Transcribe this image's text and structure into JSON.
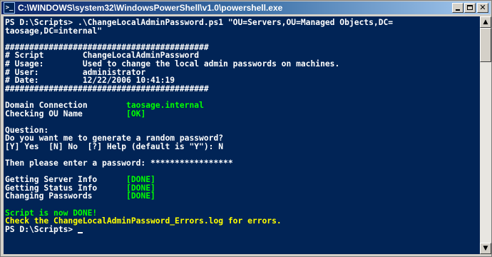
{
  "window": {
    "title": "C:\\WINDOWS\\system32\\WindowsPowerShell\\v1.0\\powershell.exe",
    "icon": "powershell-icon",
    "buttons": [
      "minimize-icon",
      "maximize-icon",
      "close-icon"
    ]
  },
  "colors": {
    "console_bg": "#012456",
    "text": "#ffffff",
    "green": "#00ff00",
    "yellow": "#ffff00"
  },
  "console": {
    "lines": [
      {
        "text": "PS D:\\Scripts> .\\ChangeLocalAdminPassword.ps1 \"OU=Servers,OU=Managed Objects,DC=",
        "color": "white"
      },
      {
        "text": "taosage,DC=internal\"",
        "color": "white"
      },
      {
        "text": "",
        "color": "white"
      },
      {
        "text": "##########################################",
        "color": "white"
      },
      {
        "text": "# Script        ChangeLocalAdminPassword",
        "color": "white"
      },
      {
        "text": "# Usage:        Used to change the local admin passwords on machines.",
        "color": "white"
      },
      {
        "text": "# User:         administrator",
        "color": "white"
      },
      {
        "text": "# Date:         12/22/2006 10:41:19",
        "color": "white"
      },
      {
        "text": "##########################################",
        "color": "white"
      },
      {
        "text": "",
        "color": "white"
      },
      {
        "segments": [
          {
            "text": "Domain Connection        ",
            "color": "white"
          },
          {
            "text": "taosage.internal",
            "color": "green"
          }
        ]
      },
      {
        "segments": [
          {
            "text": "Checking OU Name         ",
            "color": "white"
          },
          {
            "text": "[OK]",
            "color": "green"
          }
        ]
      },
      {
        "text": "",
        "color": "white"
      },
      {
        "text": "Question:",
        "color": "white"
      },
      {
        "text": "Do you want me to generate a random password?",
        "color": "white"
      },
      {
        "text": "[Y] Yes  [N] No  [?] Help (default is \"Y\"): N",
        "color": "white"
      },
      {
        "text": "",
        "color": "white"
      },
      {
        "text": "Then please enter a password: *****************",
        "color": "white"
      },
      {
        "text": "",
        "color": "white"
      },
      {
        "segments": [
          {
            "text": "Getting Server Info      ",
            "color": "white"
          },
          {
            "text": "[DONE]",
            "color": "green"
          }
        ]
      },
      {
        "segments": [
          {
            "text": "Getting Status Info      ",
            "color": "white"
          },
          {
            "text": "[DONE]",
            "color": "green"
          }
        ]
      },
      {
        "segments": [
          {
            "text": "Changing Passwords       ",
            "color": "white"
          },
          {
            "text": "[DONE]",
            "color": "green"
          }
        ]
      },
      {
        "text": "",
        "color": "white"
      },
      {
        "text": "Script is now DONE!",
        "color": "green"
      },
      {
        "text": "Check the ChangeLocalAdminPassword_Errors.log for errors.",
        "color": "yellow"
      },
      {
        "text": "PS D:\\Scripts> ",
        "color": "white",
        "cursor": true
      }
    ]
  }
}
